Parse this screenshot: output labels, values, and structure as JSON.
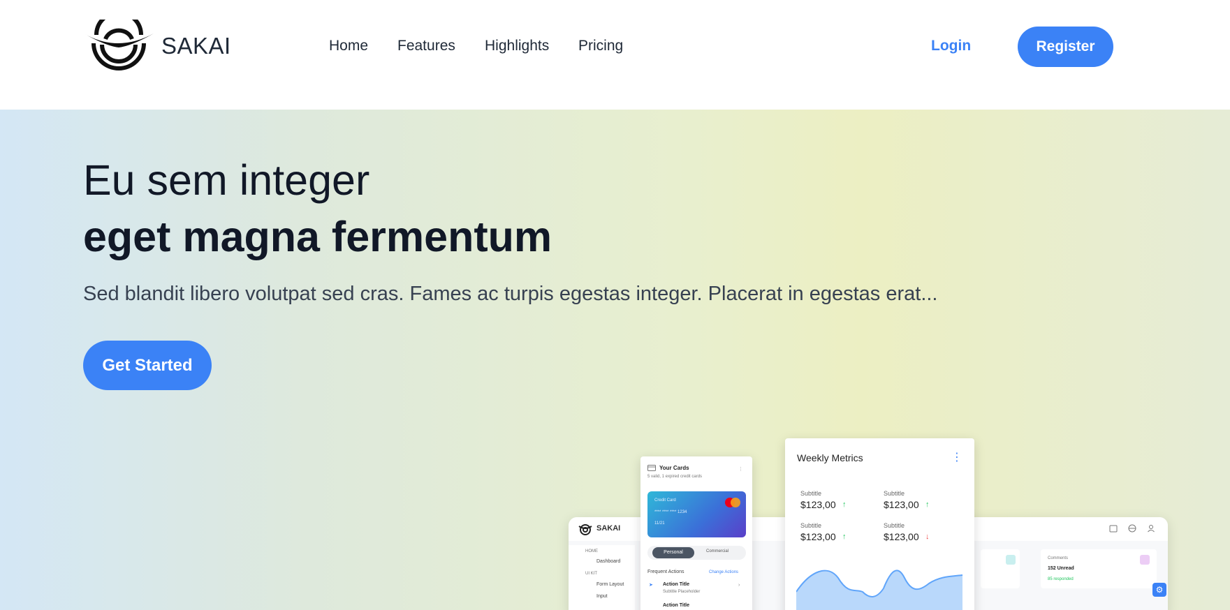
{
  "header": {
    "brand": "SAKAI",
    "nav": [
      "Home",
      "Features",
      "Highlights",
      "Pricing"
    ],
    "login_label": "Login",
    "register_label": "Register"
  },
  "hero": {
    "title_light": "Eu sem integer",
    "title_bold": "eget magna fermentum",
    "subtitle": "Sed blandit libero volutpat sed cras. Fames ac turpis egestas integer. Placerat in egestas erat...",
    "cta_label": "Get Started"
  },
  "mockup": {
    "dashboard": {
      "brand": "SAKAI",
      "menu_home": "HOME",
      "menu_dashboard": "Dashboard",
      "menu_uikit": "UI KIT",
      "menu_form": "Form Layout",
      "menu_input": "Input",
      "comments_label": "Comments",
      "comments_value": "152 Unread",
      "comments_sub": "85 responded"
    },
    "cards": {
      "title": "Your Cards",
      "subtitle": "5 valid, 1 expired credit cards",
      "card_label": "Credit Card",
      "card_number": "**** **** **** 1234",
      "card_expiry": "11/21",
      "tab_personal": "Personal",
      "tab_commercial": "Commercial",
      "frequent_actions": "Frequent Actions",
      "change_actions": "Change Actions",
      "action_title": "Action Title",
      "action_sub": "Subtitle Placeholder",
      "action_title_2": "Action Title"
    },
    "metrics": {
      "title": "Weekly Metrics",
      "items": [
        {
          "label": "Subtitle",
          "value": "$123,00",
          "trend": "↑"
        },
        {
          "label": "Subtitle",
          "value": "$123,00",
          "trend": "↑"
        },
        {
          "label": "Subtitle",
          "value": "$123,00",
          "trend": "↑"
        },
        {
          "label": "Subtitle",
          "value": "$123,00",
          "trend": "↓"
        }
      ]
    }
  },
  "colors": {
    "accent": "#3b82f6",
    "text_dark": "#111827"
  }
}
